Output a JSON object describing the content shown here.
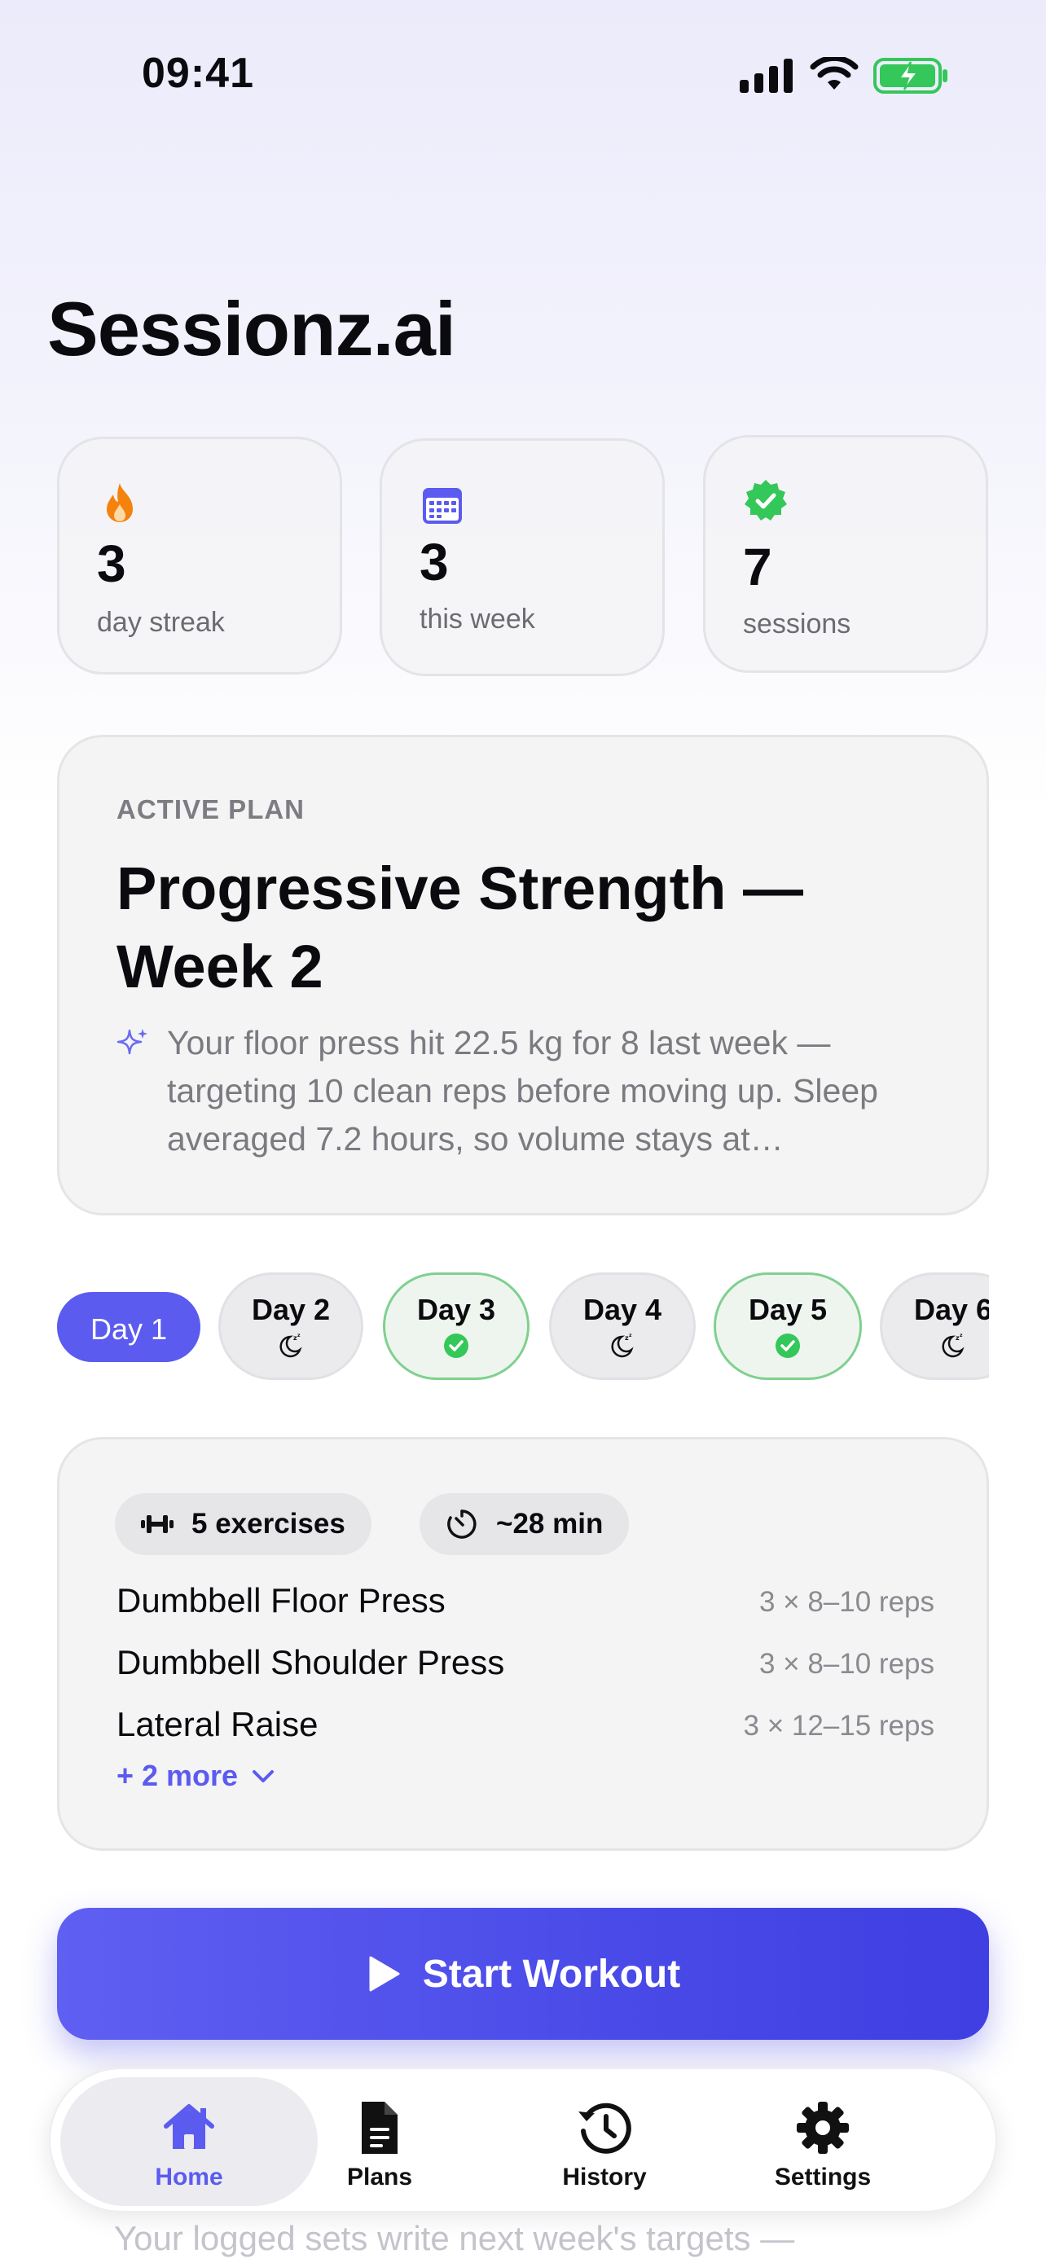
{
  "status_bar": {
    "time": "09:41"
  },
  "app": {
    "title": "Sessionz.ai"
  },
  "stats": {
    "streak": {
      "value": "3",
      "label": "day streak",
      "icon": "flame-icon"
    },
    "week": {
      "value": "3",
      "label": "this week",
      "icon": "calendar-icon"
    },
    "sessions": {
      "value": "7",
      "label": "sessions",
      "icon": "verified-badge-icon"
    }
  },
  "plan": {
    "eyebrow": "ACTIVE PLAN",
    "title": "Progressive Strength — Week 2",
    "note": "Your floor press hit 22.5 kg for 8 last week — targeting 10 clean reps before moving up. Sleep averaged 7.2 hours, so volume stays at…"
  },
  "days": [
    {
      "label": "Day 1",
      "state": "active"
    },
    {
      "label": "Day 2",
      "state": "rest",
      "icon": "moon-sleep-icon"
    },
    {
      "label": "Day 3",
      "state": "done",
      "icon": "check-circle-icon"
    },
    {
      "label": "Day 4",
      "state": "rest",
      "icon": "moon-sleep-icon"
    },
    {
      "label": "Day 5",
      "state": "done",
      "icon": "check-circle-icon"
    },
    {
      "label": "Day 6",
      "state": "rest",
      "icon": "moon-sleep-icon"
    }
  ],
  "workout": {
    "exercise_count": "5 exercises",
    "duration": "~28 min",
    "exercises": [
      {
        "name": "Dumbbell Floor Press",
        "sets": "3 × 8–10 reps"
      },
      {
        "name": "Dumbbell Shoulder Press",
        "sets": "3 × 8–10 reps"
      },
      {
        "name": "Lateral Raise",
        "sets": "3 × 12–15 reps"
      }
    ],
    "more_label": "+ 2 more"
  },
  "start_button": {
    "label": "Start Workout"
  },
  "background_peek": {
    "text": "Your logged sets write next week's targets —"
  },
  "tabs": [
    {
      "label": "Home",
      "icon": "home-icon",
      "active": true
    },
    {
      "label": "Plans",
      "icon": "document-icon",
      "active": false
    },
    {
      "label": "History",
      "icon": "history-icon",
      "active": false
    },
    {
      "label": "Settings",
      "icon": "gear-icon",
      "active": false
    }
  ],
  "colors": {
    "accent": "#5b5bf0",
    "success": "#34c759",
    "flame": "#f5820d"
  }
}
